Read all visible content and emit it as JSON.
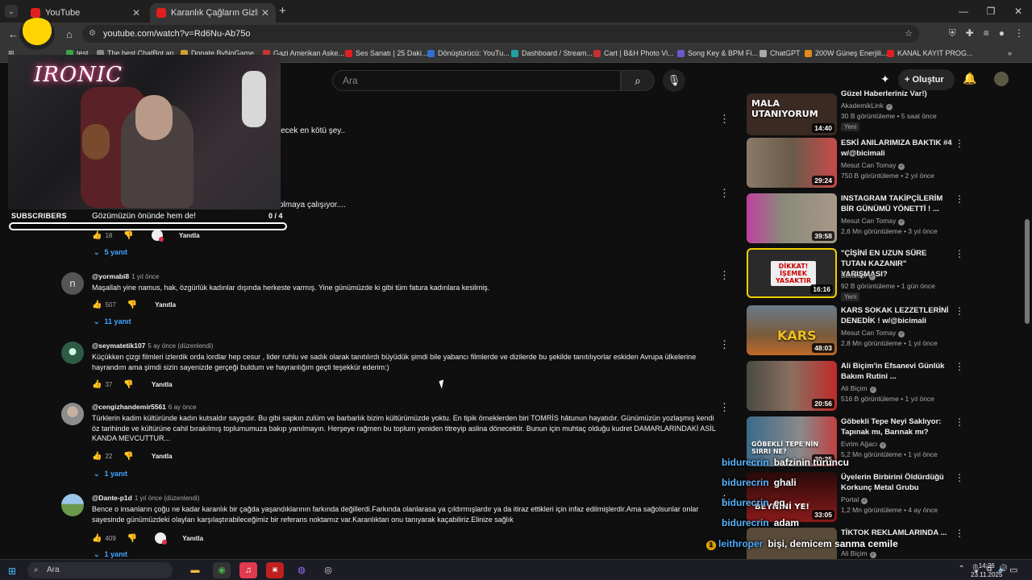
{
  "browser": {
    "tabs": [
      {
        "label": "YouTube",
        "active": false
      },
      {
        "label": "Karanlık Çağların Gizli Yüzü: Or",
        "active": true
      }
    ],
    "url": "youtube.com/watch?v=Rd6Nu-Ab75o",
    "bookmarks": [
      {
        "label": "test",
        "color": "#3aa845"
      },
      {
        "label": "The best ChatBot an...",
        "color": "#888888"
      },
      {
        "label": "Donate ByNoGame...",
        "color": "#d0a030"
      },
      {
        "label": "Gazi Amerikan Aske...",
        "color": "#cc3333"
      },
      {
        "label": "Ses Sanatı | 25 Daki...",
        "color": "#e02020"
      },
      {
        "label": "Dönüştürücü: YouTu...",
        "color": "#3070d0"
      },
      {
        "label": "Dashboard / Stream...",
        "color": "#20a0a0"
      },
      {
        "label": "Cart | B&H Photo Vi...",
        "color": "#c03030"
      },
      {
        "label": "Song Key & BPM Fi...",
        "color": "#6a5acd"
      },
      {
        "label": "ChatGPT",
        "color": "#aaaaaa"
      },
      {
        "label": "200W Güneş Enerjili...",
        "color": "#e08a20"
      },
      {
        "label": "KANAL KAYIT PROG...",
        "color": "#e02020"
      }
    ]
  },
  "header": {
    "search_placeholder": "Ara",
    "create_label": "Oluştur"
  },
  "overlay": {
    "logo_text": "IRONIC",
    "goal_label": "SUBSCRIBERS",
    "goal_text": "Gözümüzün önünde hem de!",
    "goal_count": "0 / 4",
    "goal_progress": 0
  },
  "comments": {
    "partial_lines": [
      "lecek en kötü şey..",
      "olmaya çalışıyor...."
    ],
    "partial_actions": {
      "likes": "18",
      "reply": "Yanıtla"
    },
    "partial_replies": "5 yanıt",
    "items": [
      {
        "author": "@yormabi8",
        "meta": "1 yıl önce",
        "text": "Maşallah yine namus, hak, özgürlük kadınlar dışında herkeste varmış. Yine günümüzde ki gibi tüm fatura kadınlara kesilmiş.",
        "likes": "507",
        "reply": "Yanıtla",
        "replies": "11 yanıt",
        "avatar_color": "#555555",
        "avatar_letter": "n"
      },
      {
        "author": "@seymatetik107",
        "meta": "5 ay önce (düzenlendi)",
        "text": "Küçükken çizgi filmleri izlerdik orda lordlar hep cesur , lider ruhlu ve sadık olarak tanıtılırdı büyüdük şimdi bile yabancı filmlerde ve dizilerde bu şekilde tanıtılıyorlar eskiden Avrupa ülkelerine hayrandım ama şimdi sizin sayenizde gerçeği buldum ve  hayranlığım geçti teşekkür ederim:)",
        "likes": "37",
        "reply": "Yanıtla",
        "avatar_color": "#2f5a44"
      },
      {
        "author": "@cengizhandemir5561",
        "meta": "6 ay önce",
        "text": "Türklerin kadim kültüründe kadın kutsaldır saygıdır. Bu gibi sapkın zulüm ve barbarlık bizim kültürümüzde yoktu. En tipik örneklerden biri TOMRİS hâtunun hayatıdır. Günümüzün yozlaşmış kendi öz tarihinde ve kültürüne cahil bırakılmış toplumumuza bakıp yanılmayın. Herşeye rağmen bu toplum yeniden titreyip aslina dönecektir. Bunun için muhtaç olduğu kudret DAMARLARINDAKİ ASİL KANDA MEVCUTTUR...",
        "likes": "22",
        "reply": "Yanıtla",
        "replies": "1 yanıt",
        "avatar_color": "#8c8c8c"
      },
      {
        "author": "@Dante-p1d",
        "meta": "1 yıl önce (düzenlendi)",
        "text": "Bence o insanların çoğu ne kadar karanlık bir çağda yaşandıklarının farkında değillerdi.Farkında olanlarasa ya çıldırmışlardır ya da itiraz ettikleri için infaz edilmişlerdir.Ama sağolsunlar onlar sayesinde günümüzdeki olayları karşılaştırabileceğimiz bir referans noktamız var.Karanlıktan onu tanıyarak kaçabiliriz.Elinize sağlık",
        "likes": "409",
        "reply": "Yanıtla",
        "replies": "1 yanıt",
        "avatar_color": "#6a9a4a"
      }
    ]
  },
  "sidebar": {
    "items": [
      {
        "title": "Güzel Haberleriniz Var!)",
        "channel": "AkademikLink",
        "meta": "30 B görüntüleme • 5 saat önce",
        "badge": "Yeni",
        "duration": "14:40",
        "thumb_text": "MALA UTANIYORUM",
        "thumb_bg": "#3a2a22"
      },
      {
        "title": "ESKİ ANILARIMIZA BAKTIK #4 w/@bicimali",
        "channel": "Mesut Can Tomay",
        "meta": "750 B görüntüleme • 2 yıl önce",
        "duration": "29:24",
        "thumb_text": "",
        "thumb_bg": "#6a5a4a"
      },
      {
        "title": "INSTAGRAM TAKİPÇİLERİM BİR GÜNÜMÜ YÖNETTİ ! ...",
        "channel": "Mesut Can Tomay",
        "meta": "2,6 Mn görüntüleme • 3 yıl önce",
        "duration": "39:58",
        "thumb_text": "",
        "thumb_bg": "#8a8a7a"
      },
      {
        "title": "\"ÇİŞİNİ EN UZUN SÜRE TUTAN KAZANIR\" YARIŞMASI?",
        "channel": "Bentropi",
        "meta": "92 B görüntüleme • 1 gün önce",
        "badge": "Yeni",
        "duration": "16:16",
        "thumb_text": "DİKKAT! İŞEMEK YASAKTIR",
        "thumb_bg": "#2a2a2a"
      },
      {
        "title": "KARS SOKAK LEZZETLERİNİ DENEDİK ! w/@bicimali",
        "channel": "Mesut Can Tomay",
        "meta": "2,8 Mn görüntüleme • 1 yıl önce",
        "duration": "48:03",
        "thumb_text": "KARS",
        "thumb_bg": "#7a5a3a"
      },
      {
        "title": "Ali Biçim'in Efsanevi Günlük Bakım Rutini ...",
        "channel": "Ali Biçim",
        "meta": "516 B görüntüleme • 1 yıl önce",
        "duration": "20:56",
        "thumb_text": "",
        "thumb_bg": "#c02a2a"
      },
      {
        "title": "Göbekli Tepe Neyi Saklıyor: Tapınak mı, Barınak mı?",
        "channel": "Evrim Ağacı",
        "meta": "5,2 Mn görüntüleme • 1 yıl önce",
        "duration": "30:25",
        "thumb_text": "GÖBEKLİ TEPE'NİN SIRRI NE?",
        "thumb_bg": "#3a6a8a"
      },
      {
        "title": "Üyelerin Birbirini Öldürdüğü Korkunç Metal Grubu",
        "channel": "Portal",
        "meta": "1,2 Mn görüntüleme • 4 ay önce",
        "duration": "33:05",
        "thumb_text": "BEYNİNİ YE!",
        "thumb_bg": "#4a0a0a"
      },
      {
        "title": "TİKTOK REKLAMLARINDA ...",
        "channel": "Ali Biçim",
        "meta": "",
        "duration": "",
        "thumb_text": "",
        "thumb_bg": "#5a4a3a"
      }
    ]
  },
  "chat": [
    {
      "user": "bidurecrin",
      "message": "bafzinin turuncu"
    },
    {
      "user": "bidurecrin",
      "message": "ghali"
    },
    {
      "user": "bidurecrin",
      "message": "eq"
    },
    {
      "user": "bidurecrin",
      "message": "adam"
    },
    {
      "user": "leithroper",
      "message": "bişi, demicem sanma cemile"
    }
  ],
  "taskbar": {
    "search": "Ara",
    "time": "14:26",
    "date": "23.11.2025"
  }
}
